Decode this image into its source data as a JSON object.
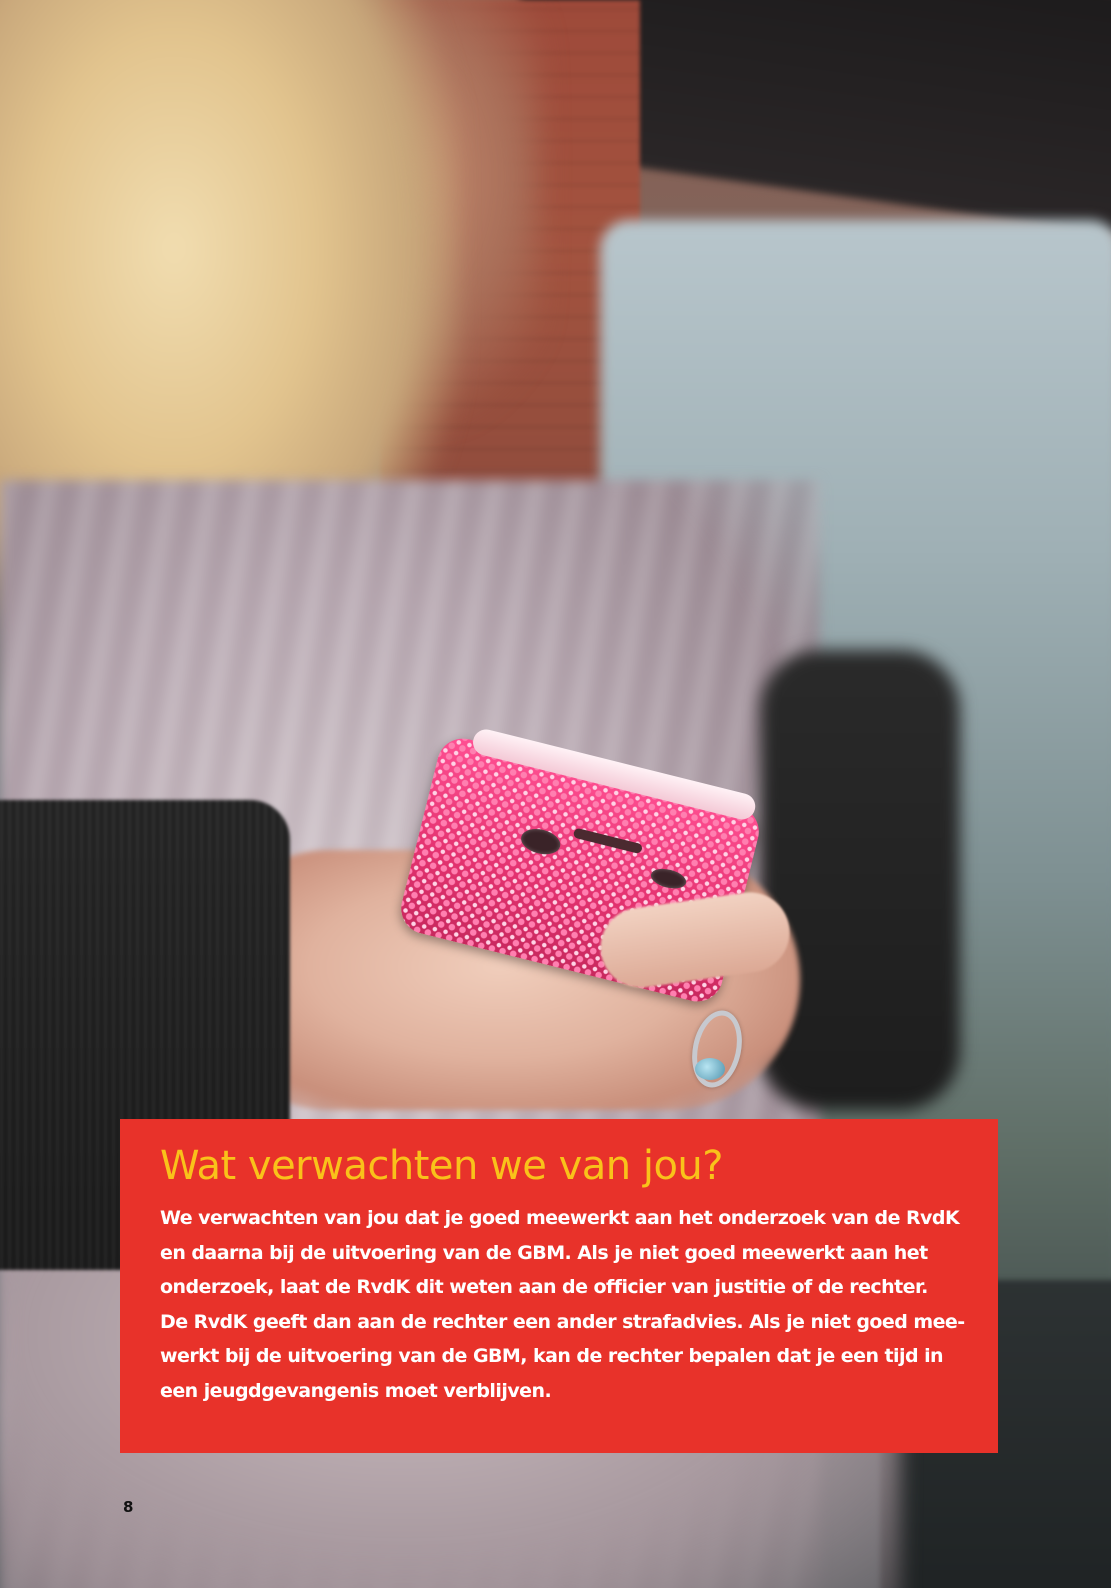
{
  "section": {
    "title": "Wat verwachten we van jou?",
    "body_lines": [
      "We verwachten van jou dat je goed meewerkt aan het onderzoek van de RvdK",
      "en daarna bij de uitvoering van de GBM. Als je niet goed meewerkt aan het",
      "onderzoek, laat de RvdK dit weten aan de officier van justitie of de rechter.",
      "De RvdK geeft dan aan de rechter een ander strafadvies. Als je niet goed mee-",
      "werkt bij de uitvoering van de GBM, kan de rechter bepalen dat je een tijd in",
      "een jeugdgevangenis moet verblijven."
    ]
  },
  "page_number": "8",
  "colors": {
    "box_background": "#e8322a",
    "title_color": "#f9c21a",
    "body_color": "#ffffff",
    "page_number_color": "#111111"
  }
}
